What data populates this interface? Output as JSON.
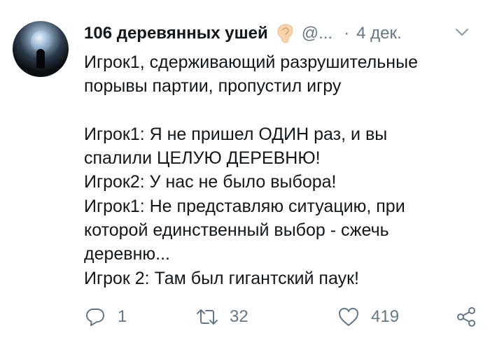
{
  "tweet": {
    "display_name": "106 деревянных ушей",
    "handle": "@...",
    "separator": "·",
    "date": "4 дек.",
    "lines": [
      "Игрок1, сдерживающий разрушительные",
      "порывы партии, пропустил игру",
      "",
      "Игрок1: Я не пришел ОДИН раз, и вы",
      "спалили ЦЕЛУЮ ДЕРЕВНЮ!",
      "Игрок2: У нас не было выбора!",
      "Игрок1: Не представляю ситуацию, при",
      "которой единственный выбор - сжечь",
      "деревню...",
      "Игрок 2: Там был гигантский паук!"
    ],
    "actions": {
      "reply_count": "1",
      "retweet_count": "32",
      "like_count": "419"
    }
  },
  "icons": {
    "name_emoji": "ear-emoji",
    "menu": "chevron-down-icon",
    "reply": "reply-icon",
    "retweet": "retweet-icon",
    "like": "heart-icon",
    "share": "share-icon"
  },
  "colors": {
    "text": "#14171a",
    "secondary": "#657786",
    "ear": "#f5d0a9"
  }
}
